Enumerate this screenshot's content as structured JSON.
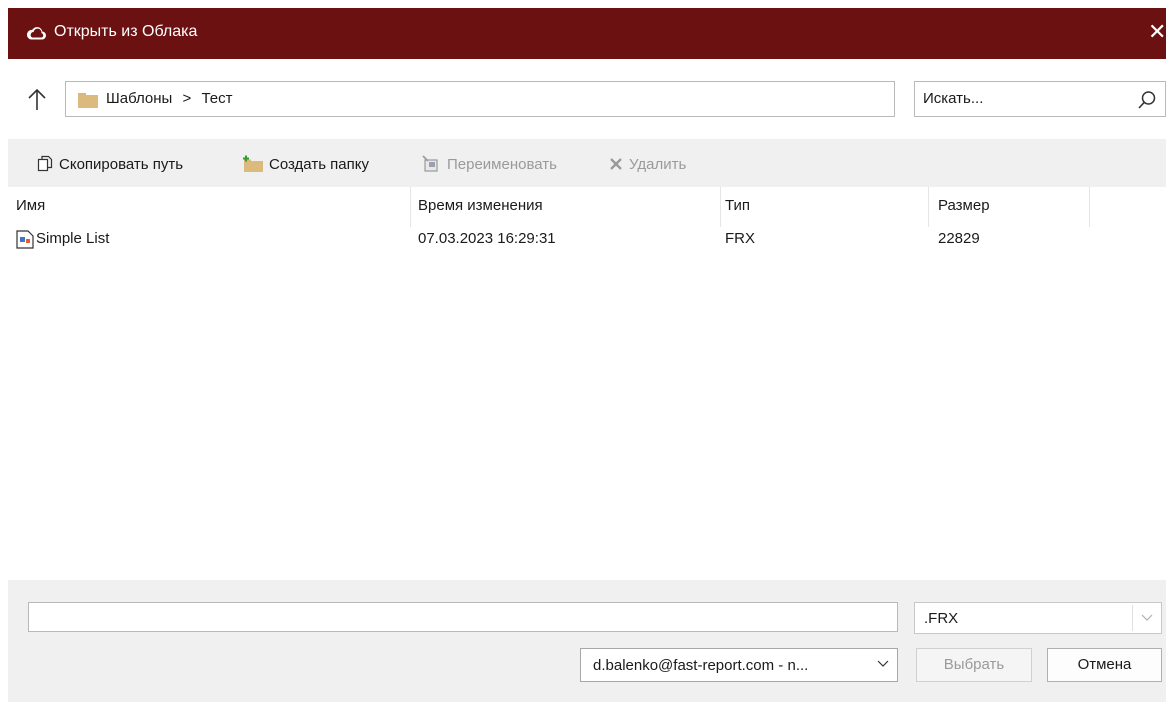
{
  "window": {
    "title": "Открыть из Облака",
    "close_glyph": "✕",
    "title_bar_color": "#6b1111"
  },
  "navigation": {
    "up_icon": "arrow-up-icon",
    "path_folder": "Шаблоны",
    "path_separator": ">",
    "path_current": "Тест",
    "search_placeholder": "Искать..."
  },
  "toolbar": {
    "copy_path": "Скопировать путь",
    "create_folder": "Создать папку",
    "rename": "Переименовать",
    "delete": "Удалить"
  },
  "file_list": {
    "columns": [
      "Имя",
      "Время изменения",
      "Тип",
      "Размер"
    ],
    "rows": [
      {
        "name": "Simple List",
        "modified": "07.03.2023 16:29:31",
        "type": "FRX",
        "size": "22829"
      }
    ]
  },
  "bottom": {
    "filename_value": "",
    "filter_value": ".FRX",
    "account_value": "d.balenko@fast-report.com - n...",
    "select_button": "Выбрать",
    "cancel_button": "Отмена"
  }
}
